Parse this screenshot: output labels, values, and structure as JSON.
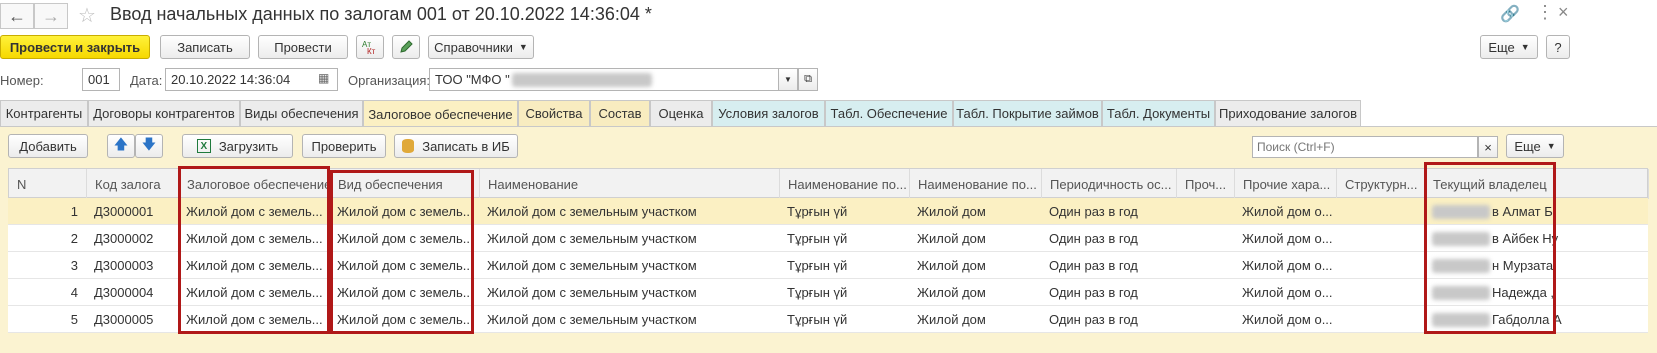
{
  "window": {
    "title": "Ввод начальных данных по залогам 001 от 20.10.2022 14:36:04 *",
    "back_icon": "arrow-left-icon",
    "forward_icon": "arrow-right-icon",
    "star_icon": "star-icon",
    "link_icon": "link-icon",
    "more_icon": "more-vertical-icon",
    "close_icon": "close-icon"
  },
  "toolbar": {
    "post_close": "Провести и закрыть",
    "save": "Записать",
    "post": "Провести",
    "references": "Справочники",
    "more": "Еще",
    "help": "?"
  },
  "header": {
    "number_label": "Номер:",
    "number_value": "001",
    "date_label": "Дата:",
    "date_value": "20.10.2022 14:36:04",
    "org_label": "Организация:",
    "org_value": "ТОО \"МФО \""
  },
  "tabs": [
    {
      "label": "Контрагенты",
      "style": "grey"
    },
    {
      "label": "Договоры контрагентов",
      "style": "grey"
    },
    {
      "label": "Виды обеспечения",
      "style": "grey"
    },
    {
      "label": "Залоговое обеспечение",
      "style": "active"
    },
    {
      "label": "Свойства",
      "style": "cream"
    },
    {
      "label": "Состав",
      "style": "cream"
    },
    {
      "label": "Оценка",
      "style": "grey"
    },
    {
      "label": "Условия залогов",
      "style": "cyan"
    },
    {
      "label": "Табл. Обеспечение",
      "style": "cyan"
    },
    {
      "label": "Табл. Покрытие займов",
      "style": "cyan"
    },
    {
      "label": "Табл. Документы",
      "style": "cyan"
    },
    {
      "label": "Приходование залогов",
      "style": "grey"
    }
  ],
  "tab_toolbar": {
    "add": "Добавить",
    "load": "Загрузить",
    "check": "Проверить",
    "write_ib": "Записать в ИБ",
    "search_placeholder": "Поиск (Ctrl+F)",
    "clear": "×",
    "more": "Еще"
  },
  "table": {
    "columns": [
      "N",
      "Код залога",
      "Залоговое обеспечение",
      "Вид обеспечения",
      "Наименование",
      "Наименование по...",
      "Наименование по...",
      "Периодичность ос...",
      "Проч...",
      "Прочие хара...",
      "Структурн...",
      "Текущий владелец"
    ],
    "rows": [
      {
        "n": "1",
        "code": "Д3000001",
        "collateral": "Жилой дом с земель...",
        "kind": "Жилой дом с земель...",
        "name": "Жилой дом с земельным участком",
        "name_kz": "Тұрғын үй",
        "name_ru": "Жилой дом",
        "period": "Один раз в год",
        "other": "",
        "other_char": "Жилой дом о...",
        "struct": "",
        "owner": "в Алмат Б"
      },
      {
        "n": "2",
        "code": "Д3000002",
        "collateral": "Жилой дом с земель...",
        "kind": "Жилой дом с земель...",
        "name": "Жилой дом с земельным участком",
        "name_kz": "Тұрғын үй",
        "name_ru": "Жилой дом",
        "period": "Один раз в год",
        "other": "",
        "other_char": "Жилой дом о...",
        "struct": "",
        "owner": "в Айбек Ну"
      },
      {
        "n": "3",
        "code": "Д3000003",
        "collateral": "Жилой дом с земель...",
        "kind": "Жилой дом с земель...",
        "name": "Жилой дом с земельным участком",
        "name_kz": "Тұрғын үй",
        "name_ru": "Жилой дом",
        "period": "Один раз в год",
        "other": "",
        "other_char": "Жилой дом о...",
        "struct": "",
        "owner": "н Мурзата"
      },
      {
        "n": "4",
        "code": "Д3000004",
        "collateral": "Жилой дом с земель...",
        "kind": "Жилой дом с земель...",
        "name": "Жилой дом с земельным участком",
        "name_kz": "Тұрғын үй",
        "name_ru": "Жилой дом",
        "period": "Один раз в год",
        "other": "",
        "other_char": "Жилой дом о...",
        "struct": "",
        "owner": "Надежда ,"
      },
      {
        "n": "5",
        "code": "Д3000005",
        "collateral": "Жилой дом с земель...",
        "kind": "Жилой дом с земель...",
        "name": "Жилой дом с земельным участком",
        "name_kz": "Тұрғын үй",
        "name_ru": "Жилой дом",
        "period": "Один раз в год",
        "other": "",
        "other_char": "Жилой дом о...",
        "struct": "",
        "owner": "Габдолла А"
      }
    ]
  },
  "colors": {
    "accent_yellow": "#f6d800",
    "selected_row": "#fbf0c3",
    "highlight_box": "#b01818"
  }
}
